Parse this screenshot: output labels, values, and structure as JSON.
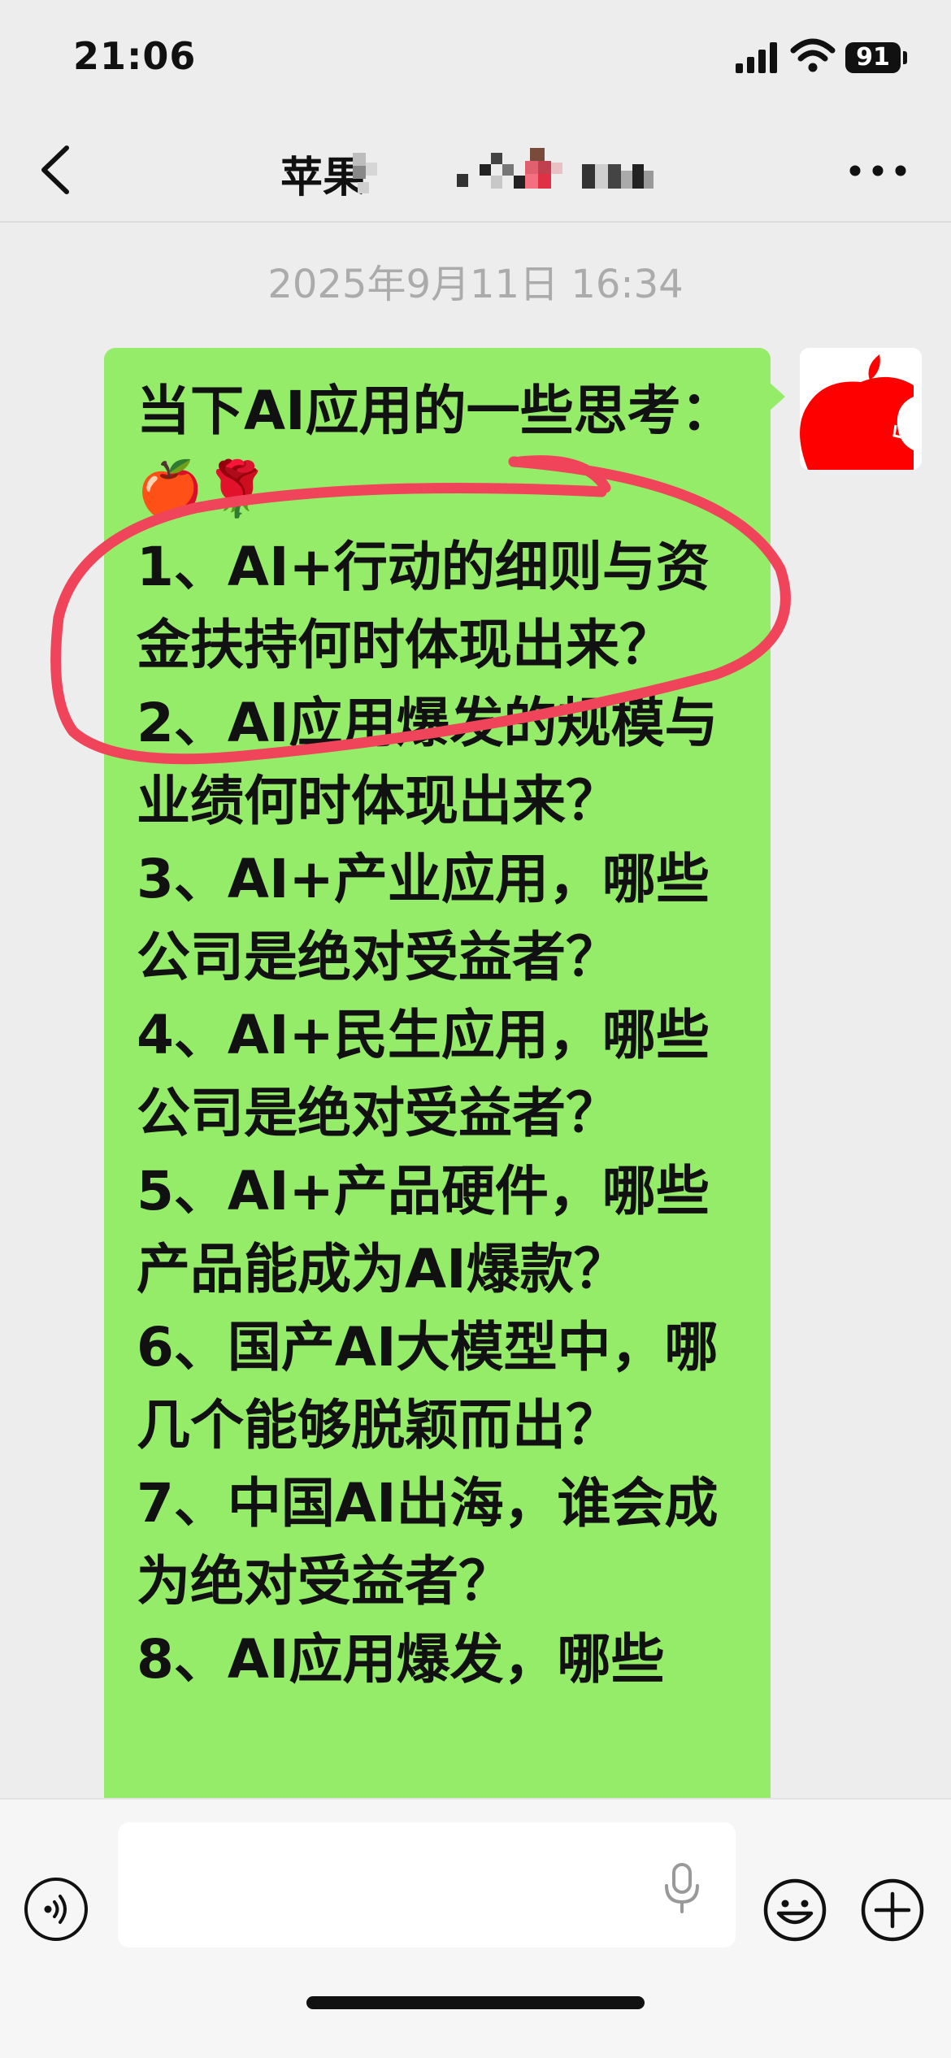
{
  "status_bar": {
    "time": "21:06",
    "battery": "91"
  },
  "header": {
    "title": "苹果"
  },
  "chat": {
    "timestamp": "2025年9月11日 16:34",
    "message": "当下AI应用的一些思考：🍎🌹\n1、AI+行动的细则与资金扶持何时体现出来？\n2、AI应用爆发的规模与业绩何时体现出来？\n3、AI+产业应用，哪些公司是绝对受益者？\n4、AI+民生应用，哪些公司是绝对受益者？\n5、AI+产品硬件，哪些产品能成为AI爆款？\n6、国产AI大模型中，哪几个能够脱颖而出？\n7、中国AI出海，谁会成为绝对受益者？\n8、AI应用爆发，哪些"
  },
  "input": {
    "value": ""
  },
  "icons": {
    "back": "chevron-left-icon",
    "more": "more-dots-icon",
    "voice": "voice-icon",
    "mic": "microphone-icon",
    "emoji": "emoji-icon",
    "plus": "plus-icon"
  },
  "colors": {
    "bubble": "#95ec69",
    "background": "#ededed",
    "annotation": "#f0445a",
    "avatar": "#ff0000"
  }
}
